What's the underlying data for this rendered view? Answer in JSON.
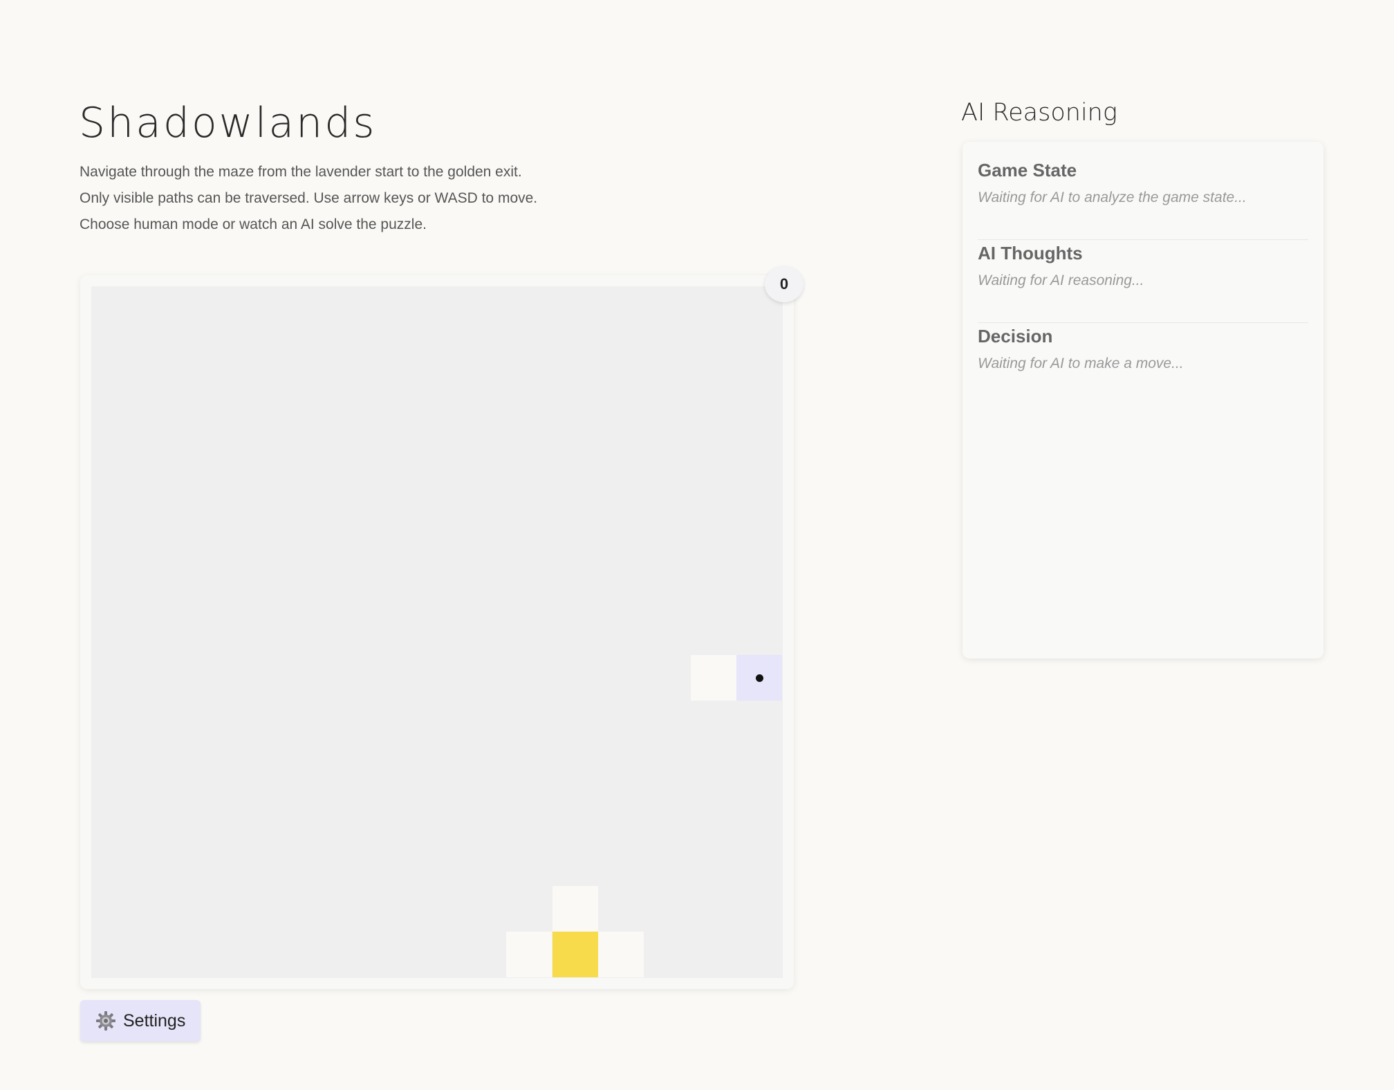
{
  "header": {
    "title": "Shadowlands",
    "description_lines": [
      "Navigate through the maze from the lavender start to the golden exit.",
      "Only visible paths can be traversed. Use arrow keys or WASD to move.",
      "Choose human mode or watch an AI solve the puzzle."
    ]
  },
  "game": {
    "move_count": "0",
    "colors": {
      "start_lavender": "#e6e5fa",
      "exit_gold": "#f7db4a",
      "hidden": "#efefef",
      "visible_path": "#faf9f6"
    }
  },
  "controls": {
    "settings_label": "Settings",
    "settings_icon": "gear-icon"
  },
  "ai": {
    "title": "AI Reasoning",
    "sections": [
      {
        "heading": "Game State",
        "text": "Waiting for AI to analyze the game state..."
      },
      {
        "heading": "AI Thoughts",
        "text": "Waiting for AI reasoning..."
      },
      {
        "heading": "Decision",
        "text": "Waiting for AI to make a move..."
      }
    ]
  }
}
